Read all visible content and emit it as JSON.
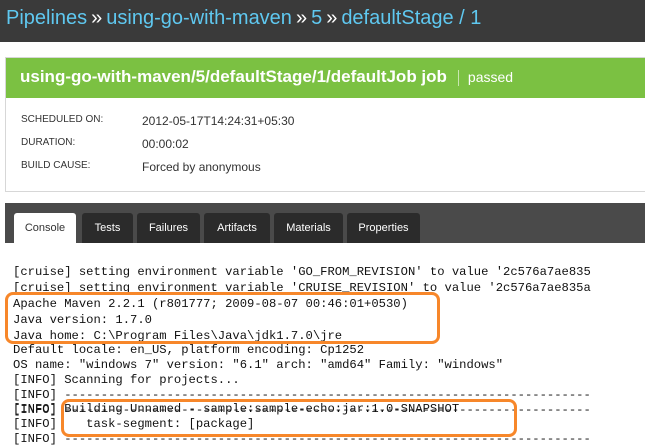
{
  "breadcrumb": {
    "pipelines": "Pipelines",
    "sep1": "»",
    "pipeline_name": "using-go-with-maven",
    "sep2": "»",
    "counter": "5",
    "sep3": "»",
    "stage": "defaultStage / 1"
  },
  "job": {
    "title": "using-go-with-maven/5/defaultStage/1/defaultJob job",
    "status": "passed",
    "header_color": "#7bc142"
  },
  "details": [
    {
      "label": "SCHEDULED ON:",
      "value": "2012-05-17T14:24:31+05:30"
    },
    {
      "label": "DURATION:",
      "value": "00:00:02"
    },
    {
      "label": "BUILD CAUSE:",
      "value": "Forced by anonymous"
    }
  ],
  "tabs": [
    {
      "label": "Console",
      "active": true
    },
    {
      "label": "Tests",
      "active": false
    },
    {
      "label": "Failures",
      "active": false
    },
    {
      "label": "Artifacts",
      "active": false
    },
    {
      "label": "Materials",
      "active": false
    },
    {
      "label": "Properties",
      "active": false
    }
  ],
  "console_lines": [
    "[cruise] setting environment variable 'GO_FROM_REVISION' to value '2c576a7ae835",
    "[cruise] setting environment variable 'CRUISE_REVISION' to value '2c576a7ae835a",
    "Apache Maven 2.2.1 (r801777; 2009-08-07 00:46:01+0530)",
    "Java version: 1.7.0",
    "Java home: C:\\Program Files\\Java\\jdk1.7.0\\jre",
    "Default locale: en_US, platform encoding: Cp1252",
    "OS name: \"windows 7\" version: \"6.1\" arch: \"amd64\" Family: \"windows\"",
    "[INFO] Scanning for projects...",
    "[INFO] ------------------------------------------------------------------------",
    "[INFO] ------------------------------------------------------------------------",
    "[INFO] Building Unnamed - sample:sample-echo:jar:1.0-SNAPSHOT",
    "[INFO]    task-segment: [package]",
    "[INFO] ------------------------------------------------------------------------"
  ],
  "highlight_color": "#f7872a"
}
